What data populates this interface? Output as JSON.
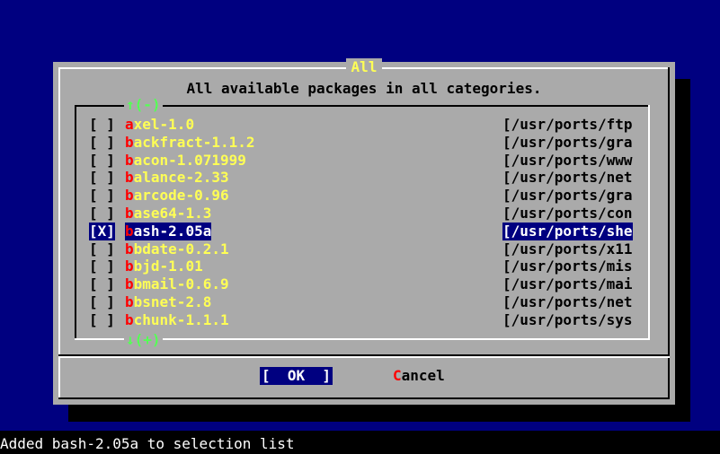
{
  "dialog": {
    "title": "All",
    "prompt": "All available packages in all categories.",
    "scroll_up": "↑(-)",
    "scroll_down": "↓(+)"
  },
  "packages": [
    {
      "checkbox": "[ ]",
      "hotkey": "a",
      "rest": "xel-1.0",
      "path": "[/usr/ports/ftp",
      "selected": false
    },
    {
      "checkbox": "[ ]",
      "hotkey": "b",
      "rest": "ackfract-1.1.2",
      "path": "[/usr/ports/gra",
      "selected": false
    },
    {
      "checkbox": "[ ]",
      "hotkey": "b",
      "rest": "acon-1.071999",
      "path": "[/usr/ports/www",
      "selected": false
    },
    {
      "checkbox": "[ ]",
      "hotkey": "b",
      "rest": "alance-2.33",
      "path": "[/usr/ports/net",
      "selected": false
    },
    {
      "checkbox": "[ ]",
      "hotkey": "b",
      "rest": "arcode-0.96",
      "path": "[/usr/ports/gra",
      "selected": false
    },
    {
      "checkbox": "[ ]",
      "hotkey": "b",
      "rest": "ase64-1.3",
      "path": "[/usr/ports/con",
      "selected": false
    },
    {
      "checkbox": "[X]",
      "hotkey": "b",
      "rest": "ash-2.05a",
      "path": "[/usr/ports/she",
      "selected": true
    },
    {
      "checkbox": "[ ]",
      "hotkey": "b",
      "rest": "bdate-0.2.1",
      "path": "[/usr/ports/x11",
      "selected": false
    },
    {
      "checkbox": "[ ]",
      "hotkey": "b",
      "rest": "bjd-1.01",
      "path": "[/usr/ports/mis",
      "selected": false
    },
    {
      "checkbox": "[ ]",
      "hotkey": "b",
      "rest": "bmail-0.6.9",
      "path": "[/usr/ports/mai",
      "selected": false
    },
    {
      "checkbox": "[ ]",
      "hotkey": "b",
      "rest": "bsnet-2.8",
      "path": "[/usr/ports/net",
      "selected": false
    },
    {
      "checkbox": "[ ]",
      "hotkey": "b",
      "rest": "chunk-1.1.1",
      "path": "[/usr/ports/sys",
      "selected": false
    }
  ],
  "buttons": {
    "ok_label": "[  OK  ]",
    "cancel_hotkey": "C",
    "cancel_rest": "ancel"
  },
  "status": "Added bash-2.05a to selection list",
  "colors": {
    "screen_bg": "#000080",
    "dialog_bg": "#aaaaaa",
    "package_name": "#ffff55",
    "hotkey": "#ff0000",
    "selection_bg": "#000080"
  }
}
